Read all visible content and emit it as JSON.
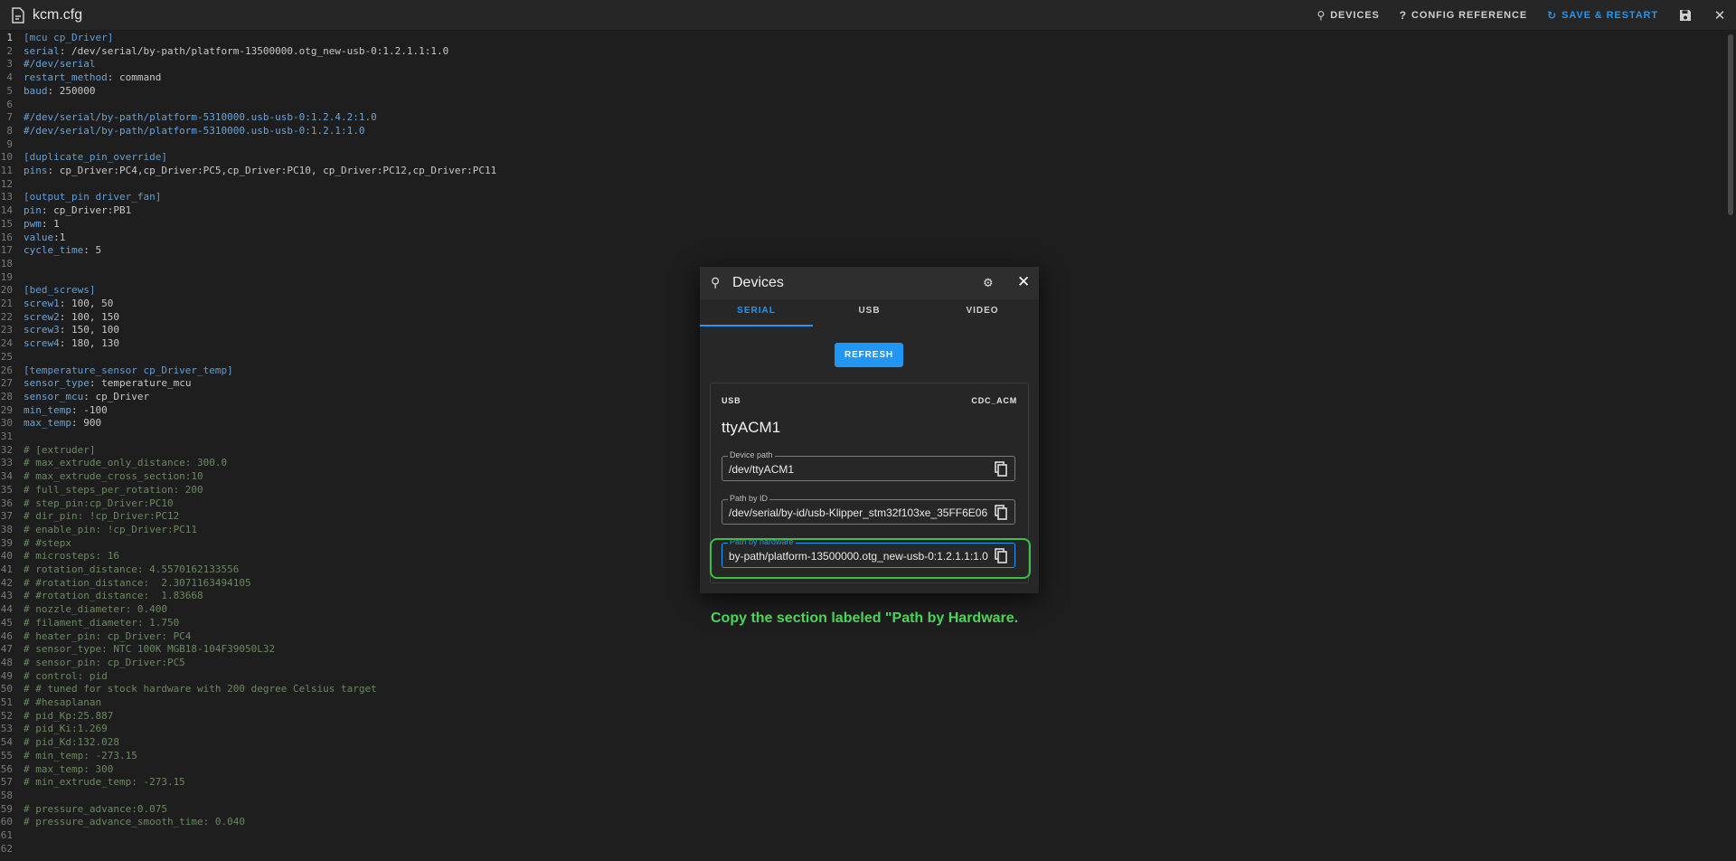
{
  "header": {
    "file_title": "kcm.cfg",
    "devices_label": "DEVICES",
    "config_reference_label": "CONFIG REFERENCE",
    "save_restart_label": "SAVE & RESTART"
  },
  "editor": {
    "lines": [
      {
        "n": "1",
        "parts": [
          [
            "s",
            "[mcu cp_Driver]"
          ]
        ]
      },
      {
        "n": "2",
        "parts": [
          [
            "k",
            "serial"
          ],
          [
            "v",
            ": /dev/serial/by-path/platform-13500000.otg_new-usb-0:1.2.1.1:1.0"
          ]
        ]
      },
      {
        "n": "3",
        "parts": [
          [
            "k",
            "#/dev/serial"
          ]
        ]
      },
      {
        "n": "4",
        "parts": [
          [
            "k",
            "restart_method"
          ],
          [
            "v",
            ": command"
          ]
        ]
      },
      {
        "n": "5",
        "parts": [
          [
            "k",
            "baud"
          ],
          [
            "v",
            ": 250000"
          ]
        ]
      },
      {
        "n": "6",
        "parts": []
      },
      {
        "n": "7",
        "parts": [
          [
            "k",
            "#/dev/serial/by-path/platform-5310000.usb-usb-0:1.2.4.2:1.0"
          ]
        ]
      },
      {
        "n": "8",
        "parts": [
          [
            "k",
            "#/dev/serial/by-path/platform-5310000.usb-usb-0:1.2.1:1.0"
          ]
        ]
      },
      {
        "n": "9",
        "parts": []
      },
      {
        "n": "10",
        "parts": [
          [
            "s",
            "[duplicate_pin_override]"
          ]
        ]
      },
      {
        "n": "11",
        "parts": [
          [
            "k",
            "pins"
          ],
          [
            "v",
            ": cp_Driver:PC4,cp_Driver:PC5,cp_Driver:PC10, cp_Driver:PC12,cp_Driver:PC11"
          ]
        ]
      },
      {
        "n": "12",
        "parts": []
      },
      {
        "n": "13",
        "parts": [
          [
            "s",
            "[output_pin driver_fan]"
          ]
        ]
      },
      {
        "n": "14",
        "parts": [
          [
            "k",
            "pin"
          ],
          [
            "v",
            ": cp_Driver:PB1"
          ]
        ]
      },
      {
        "n": "15",
        "parts": [
          [
            "k",
            "pwm"
          ],
          [
            "v",
            ": 1"
          ]
        ]
      },
      {
        "n": "16",
        "parts": [
          [
            "k",
            "value"
          ],
          [
            "v",
            ":1"
          ]
        ]
      },
      {
        "n": "17",
        "parts": [
          [
            "k",
            "cycle_time"
          ],
          [
            "v",
            ": 5"
          ]
        ]
      },
      {
        "n": "18",
        "parts": []
      },
      {
        "n": "19",
        "parts": []
      },
      {
        "n": "20",
        "parts": [
          [
            "s",
            "[bed_screws]"
          ]
        ]
      },
      {
        "n": "21",
        "parts": [
          [
            "k",
            "screw1"
          ],
          [
            "v",
            ": 100, 50"
          ]
        ]
      },
      {
        "n": "22",
        "parts": [
          [
            "k",
            "screw2"
          ],
          [
            "v",
            ": 100, 150"
          ]
        ]
      },
      {
        "n": "23",
        "parts": [
          [
            "k",
            "screw3"
          ],
          [
            "v",
            ": 150, 100"
          ]
        ]
      },
      {
        "n": "24",
        "parts": [
          [
            "k",
            "screw4"
          ],
          [
            "v",
            ": 180, 130"
          ]
        ]
      },
      {
        "n": "25",
        "parts": []
      },
      {
        "n": "26",
        "parts": [
          [
            "s",
            "[temperature_sensor cp_Driver_temp]"
          ]
        ]
      },
      {
        "n": "27",
        "parts": [
          [
            "k",
            "sensor_type"
          ],
          [
            "v",
            ": temperature_mcu"
          ]
        ]
      },
      {
        "n": "28",
        "parts": [
          [
            "k",
            "sensor_mcu"
          ],
          [
            "v",
            ": cp_Driver"
          ]
        ]
      },
      {
        "n": "29",
        "parts": [
          [
            "k",
            "min_temp"
          ],
          [
            "v",
            ": -100"
          ]
        ]
      },
      {
        "n": "30",
        "parts": [
          [
            "k",
            "max_temp"
          ],
          [
            "v",
            ": 900"
          ]
        ]
      },
      {
        "n": "31",
        "parts": []
      },
      {
        "n": "32",
        "parts": [
          [
            "c",
            "# [extruder]"
          ]
        ]
      },
      {
        "n": "33",
        "parts": [
          [
            "c",
            "# max_extrude_only_distance: 300.0"
          ]
        ]
      },
      {
        "n": "34",
        "parts": [
          [
            "c",
            "# max_extrude_cross_section:10"
          ]
        ]
      },
      {
        "n": "35",
        "parts": [
          [
            "c",
            "# full_steps_per_rotation: 200"
          ]
        ]
      },
      {
        "n": "36",
        "parts": [
          [
            "c",
            "# step_pin:cp_Driver:PC10"
          ]
        ]
      },
      {
        "n": "37",
        "parts": [
          [
            "c",
            "# dir_pin: !cp_Driver:PC12"
          ]
        ]
      },
      {
        "n": "38",
        "parts": [
          [
            "c",
            "# enable_pin: !cp_Driver:PC11"
          ]
        ]
      },
      {
        "n": "39",
        "parts": [
          [
            "c",
            "# #stepx"
          ]
        ]
      },
      {
        "n": "40",
        "parts": [
          [
            "c",
            "# microsteps: 16"
          ]
        ]
      },
      {
        "n": "41",
        "parts": [
          [
            "c",
            "# rotation_distance: 4.5570162133556"
          ]
        ]
      },
      {
        "n": "42",
        "parts": [
          [
            "c",
            "# #rotation_distance:  2.3071163494105"
          ]
        ]
      },
      {
        "n": "43",
        "parts": [
          [
            "c",
            "# #rotation_distance:  1.83668"
          ]
        ]
      },
      {
        "n": "44",
        "parts": [
          [
            "c",
            "# nozzle_diameter: 0.400"
          ]
        ]
      },
      {
        "n": "45",
        "parts": [
          [
            "c",
            "# filament_diameter: 1.750"
          ]
        ]
      },
      {
        "n": "46",
        "parts": [
          [
            "c",
            "# heater_pin: cp_Driver: PC4"
          ]
        ]
      },
      {
        "n": "47",
        "parts": [
          [
            "c",
            "# sensor_type: NTC 100K MGB18-104F39050L32"
          ]
        ]
      },
      {
        "n": "48",
        "parts": [
          [
            "c",
            "# sensor_pin: cp_Driver:PC5"
          ]
        ]
      },
      {
        "n": "49",
        "parts": [
          [
            "c",
            "# control: pid"
          ]
        ]
      },
      {
        "n": "50",
        "parts": [
          [
            "c",
            "# # tuned for stock hardware with 200 degree Celsius target"
          ]
        ]
      },
      {
        "n": "51",
        "parts": [
          [
            "c",
            "# #hesaplanan"
          ]
        ]
      },
      {
        "n": "52",
        "parts": [
          [
            "c",
            "# pid_Kp:25.887"
          ]
        ]
      },
      {
        "n": "53",
        "parts": [
          [
            "c",
            "# pid_Ki:1.269"
          ]
        ]
      },
      {
        "n": "54",
        "parts": [
          [
            "c",
            "# pid_Kd:132.028"
          ]
        ]
      },
      {
        "n": "55",
        "parts": [
          [
            "c",
            "# min_temp: -273.15"
          ]
        ]
      },
      {
        "n": "56",
        "parts": [
          [
            "c",
            "# max_temp: 300"
          ]
        ]
      },
      {
        "n": "57",
        "parts": [
          [
            "c",
            "# min_extrude_temp: -273.15"
          ]
        ]
      },
      {
        "n": "58",
        "parts": []
      },
      {
        "n": "59",
        "parts": [
          [
            "c",
            "# pressure_advance:0.075"
          ]
        ]
      },
      {
        "n": "60",
        "parts": [
          [
            "c",
            "# pressure_advance_smooth_time: 0.040"
          ]
        ]
      },
      {
        "n": "61",
        "parts": []
      },
      {
        "n": "62",
        "parts": []
      }
    ]
  },
  "dialog": {
    "title": "Devices",
    "tabs": [
      "SERIAL",
      "USB",
      "VIDEO"
    ],
    "active_tab": "SERIAL",
    "refresh_label": "REFRESH",
    "device": {
      "type": "USB",
      "driver": "CDC_ACM",
      "name": "ttyACM1",
      "device_path_label": "Device path",
      "device_path": "/dev/ttyACM1",
      "path_by_id_label": "Path by ID",
      "path_by_id": "/dev/serial/by-id/usb-Klipper_stm32f103xe_35FF6E06",
      "path_by_hardware_label": "Path by hardware",
      "path_by_hardware": "by-path/platform-13500000.otg_new-usb-0:1.2.1.1:1.0"
    }
  },
  "annotation": {
    "text": "Copy the section labeled \"Path by Hardware."
  },
  "colors": {
    "accent": "#2196f3",
    "highlight": "#3dbf4a",
    "background": "#1e1e1e"
  }
}
